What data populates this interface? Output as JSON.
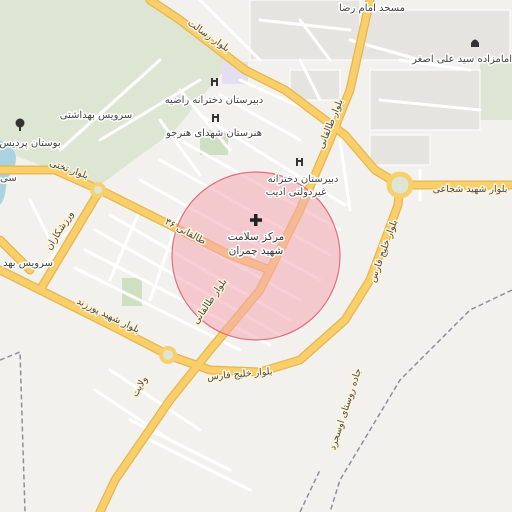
{
  "colors": {
    "background": "#f2f1ee",
    "green_area": "#dde6d3",
    "water": "#aad3df",
    "main_road": "#f8cf6b",
    "main_road_outline": "#e8b54a",
    "minor_road": "#ffffff",
    "minor_road_outline": "#dcdcdc",
    "highlight_fill": "#f4a8b4",
    "highlight_stroke": "#e0707f",
    "dashed_line": "#8f8f99"
  },
  "highlight": {
    "name_line1": "مرکز سلامت",
    "name_line2": "شهید چمران",
    "icon": "health-cross-icon"
  },
  "pois": [
    {
      "id": "mosque-imam-reza",
      "label": "مسجد امام رضا",
      "icon": "none"
    },
    {
      "id": "imamzadeh",
      "label": "امامزاده سید علی اصغر",
      "icon": "mosque-icon"
    },
    {
      "id": "girls-school-razieh",
      "label": "دبیرستان دخترانه راضیه",
      "icon": "school-icon"
    },
    {
      "id": "hozgho-school",
      "label": "هنرستان شهدای هنرجو",
      "icon": "school-icon"
    },
    {
      "id": "health-service",
      "label": "سرویس بهداشتی",
      "icon": "none"
    },
    {
      "id": "pardis-park",
      "label": "بوستان پردیس",
      "icon": "tree-icon"
    },
    {
      "id": "adib-school-line1",
      "label": "دبیرستان دخترانه",
      "icon": "school-icon"
    },
    {
      "id": "adib-school-line2",
      "label": "غیردولتی ادیب",
      "icon": "none"
    },
    {
      "id": "health-service-2",
      "label": "سرویس بهد",
      "icon": "none"
    },
    {
      "id": "cut-label",
      "label": "سی",
      "icon": "none"
    }
  ],
  "roads": {
    "resalat": "بلوار رسالت",
    "taleghani_north": "بلوار طالقانی",
    "taleghani_south": "بلوار طالقانی",
    "taleghani_street": "طالقانی ۳۶",
    "shojaei": "بلوار شهید شجاعی",
    "khalij_fars_east": "بلوار خلیج فارس",
    "khalij_fars_south": "بلوار خلیج فارس",
    "pourzand": "بلوار شهید پورزند",
    "varzeshkaran": "ورزشکاران",
    "takhti": "بلوار تختی",
    "velayat": "ولایت",
    "village_road": "جاده روستای اوسجرد"
  }
}
